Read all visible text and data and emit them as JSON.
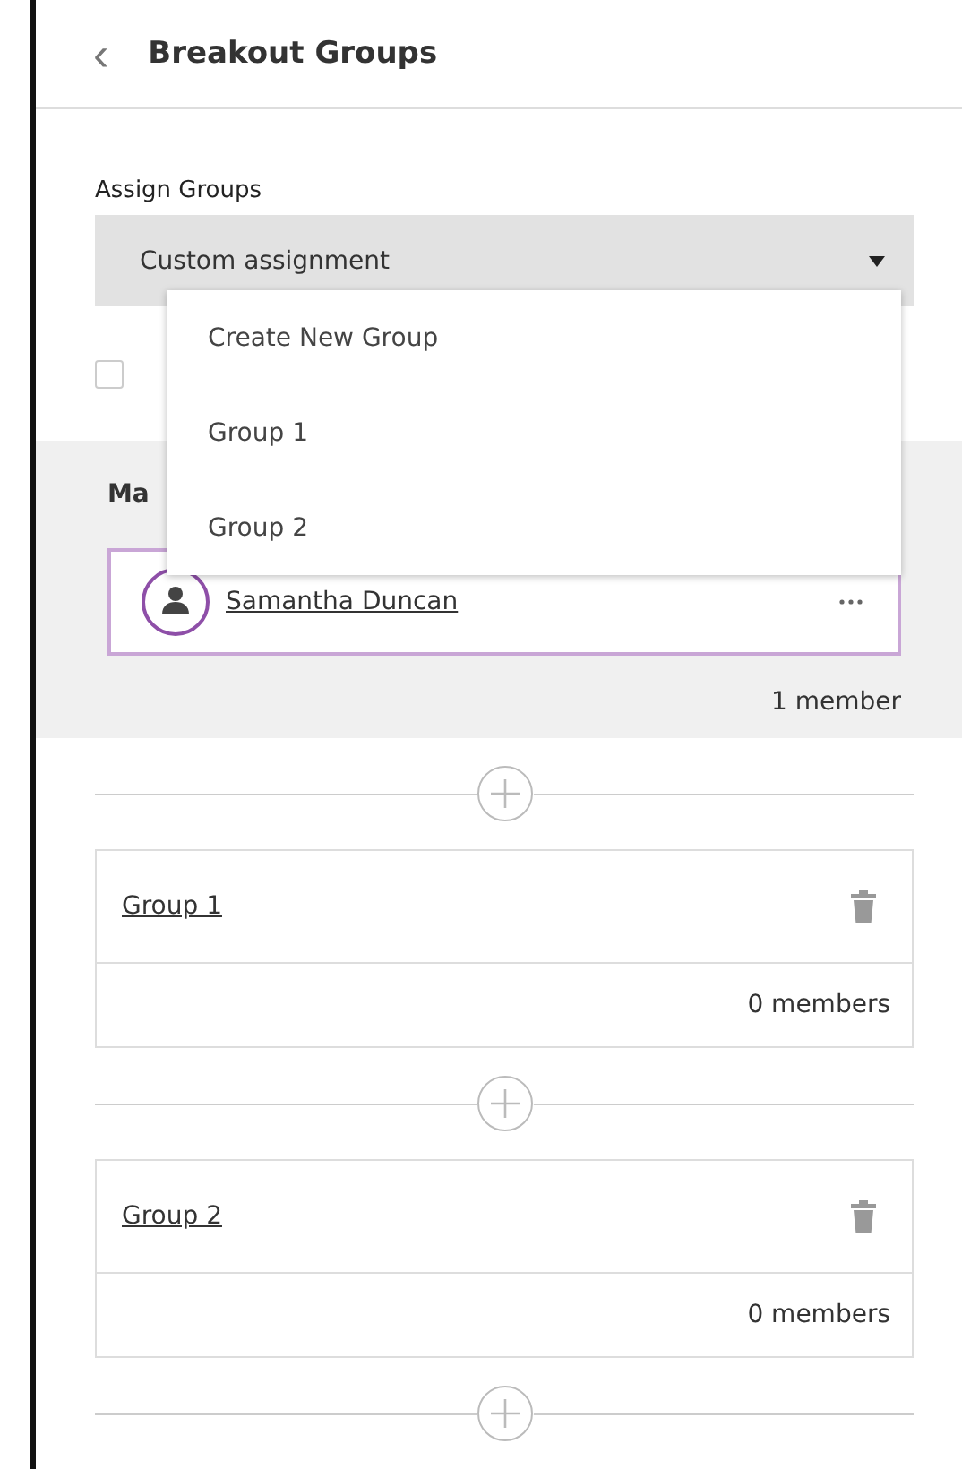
{
  "header": {
    "back_icon": "‹",
    "title": "Breakout Groups"
  },
  "assign": {
    "label": "Assign Groups",
    "value": "Custom assignment",
    "checkbox": {
      "checked": false
    }
  },
  "dropdown": {
    "open": true,
    "items": [
      {
        "label": "Create New Group"
      },
      {
        "label": "Group 1"
      },
      {
        "label": "Group 2"
      }
    ]
  },
  "main_group": {
    "label": "Ma",
    "members": [
      {
        "name": "Samantha Duncan",
        "selected": true
      }
    ],
    "count": "1 member"
  },
  "groups": [
    {
      "name": "Group 1",
      "count": "0 members"
    },
    {
      "name": "Group 2",
      "count": "0 members"
    }
  ]
}
